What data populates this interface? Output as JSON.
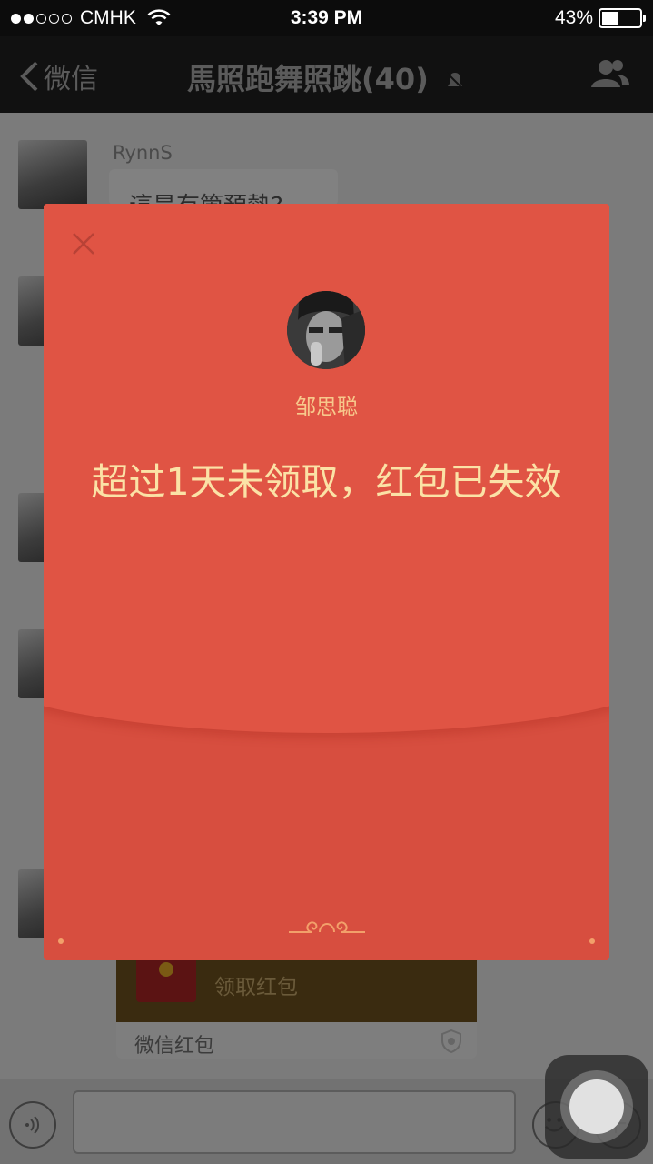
{
  "status_bar": {
    "carrier": "CMHK",
    "time": "3:39 PM",
    "battery": "43%",
    "battery_level": 0.43
  },
  "nav": {
    "back_label": "微信",
    "title": "馬照跑舞照跳(40)"
  },
  "chat": {
    "first_sender": "RynnS",
    "first_message": "這是有箇預熱?",
    "red_packet_card": {
      "action": "领取红包",
      "brand": "微信红包"
    }
  },
  "modal": {
    "sender": "邹思聪",
    "message": "超过1天未领取，红包已失效"
  },
  "colors": {
    "modal_red": "#e05444",
    "modal_text": "#fbe2a6",
    "sender_text": "#f7c98c"
  },
  "icons": [
    "wifi-icon",
    "battery-icon",
    "back-chevron-icon",
    "mute-icon",
    "contacts-icon",
    "voice-icon",
    "emoji-icon",
    "plus-icon",
    "close-icon",
    "shield-icon",
    "ornament-icon"
  ]
}
